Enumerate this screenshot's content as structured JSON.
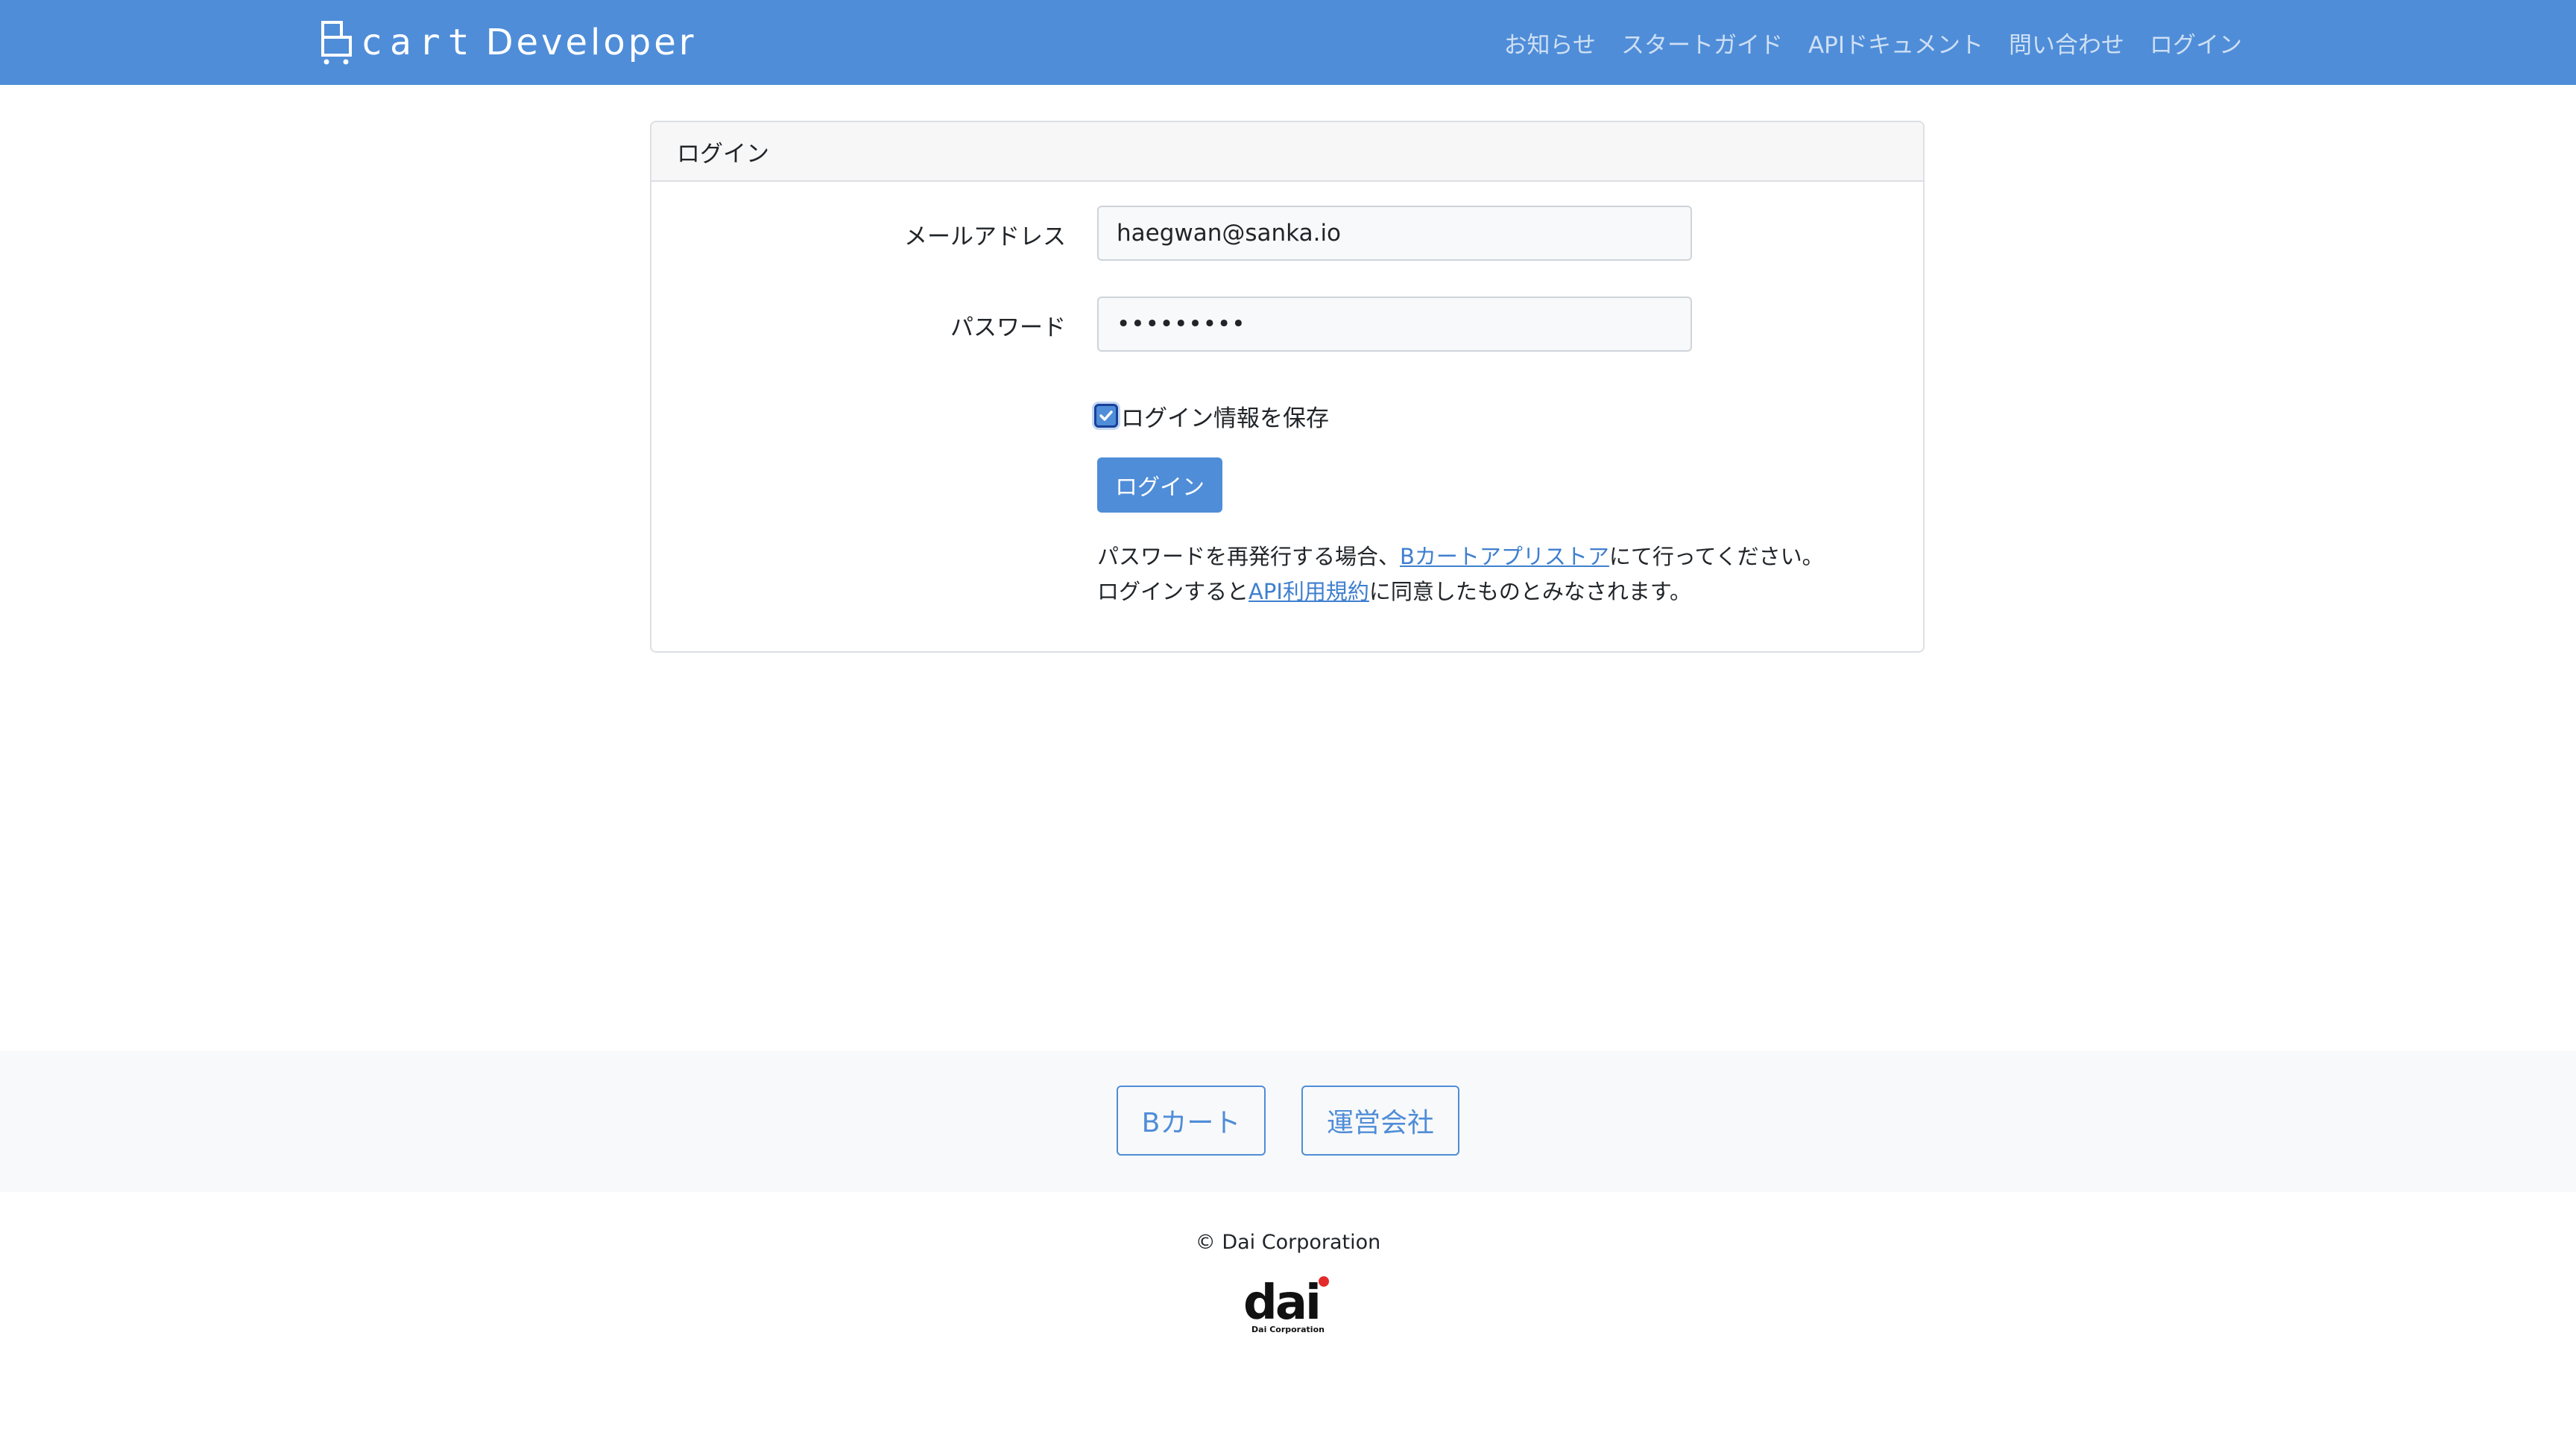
{
  "header": {
    "brand_cart": "cart",
    "brand_developer": "Developer",
    "nav": {
      "news": "お知らせ",
      "start_guide": "スタートガイド",
      "api_docs": "APIドキュメント",
      "contact": "問い合わせ",
      "login": "ログイン"
    },
    "color": "#4f8dd8"
  },
  "login_card": {
    "title": "ログイン",
    "email_label": "メールアドレス",
    "email_value": "haegwan@sanka.io",
    "password_label": "パスワード",
    "password_value": "•••••••••",
    "remember_label": "ログイン情報を保存",
    "remember_checked": true,
    "submit_label": "ログイン",
    "note_line1_pre": "パスワードを再発行する場合、",
    "note_line1_link": "Bカートアプリストア",
    "note_line1_post": "にて行ってください。",
    "note_line2_pre": "ログインすると",
    "note_line2_link": "API利用規約",
    "note_line2_post": "に同意したものとみなされます。"
  },
  "footer": {
    "bcart_button": "Bカート",
    "company_button": "運営会社",
    "copyright": "© Dai Corporation",
    "logo_text": "dai",
    "logo_subtext": "Dai Corporation"
  }
}
